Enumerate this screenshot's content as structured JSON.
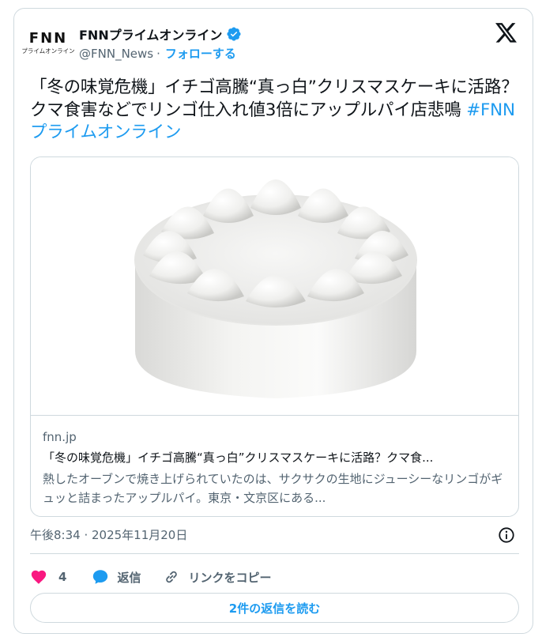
{
  "author": {
    "logo_main": "FNN",
    "logo_sub": "プライムオンライン",
    "name": "FNNプライムオンライン",
    "handle": "@FNN_News",
    "separator": "·",
    "follow_label": "フォローする",
    "verified": true
  },
  "tweet": {
    "text": "「冬の味覚危機」イチゴ高騰“真っ白”クリスマスケーキに活路？クマ食害などでリンゴ仕入れ値3倍にアップルパイ店悲鳴 ",
    "hashtag": "#FNNプライムオンライン"
  },
  "link_card": {
    "image_alt": "white cake with whipped cream",
    "domain": "fnn.jp",
    "title": "「冬の味覚危機」イチゴ高騰“真っ白”クリスマスケーキに活路？クマ食...",
    "description": "熱したオーブンで焼き上げられていたのは、サクサクの生地にジューシーなリンゴがギュッと詰まったアップルパイ。東京・文京区にある..."
  },
  "meta": {
    "timestamp": "午後8:34 · 2025年11月20日"
  },
  "actions": {
    "like_count": "4",
    "reply_label": "返信",
    "copy_link_label": "リンクをコピー"
  },
  "read_replies_label": "2件の返信を読む",
  "colors": {
    "accent": "#1d9bf0",
    "like": "#f91880",
    "text": "#0f1419",
    "muted": "#536471",
    "border": "#cfd9de"
  },
  "icons": [
    "verified-badge-icon",
    "x-logo-icon",
    "info-icon",
    "heart-icon",
    "reply-bubble-icon",
    "link-icon"
  ]
}
